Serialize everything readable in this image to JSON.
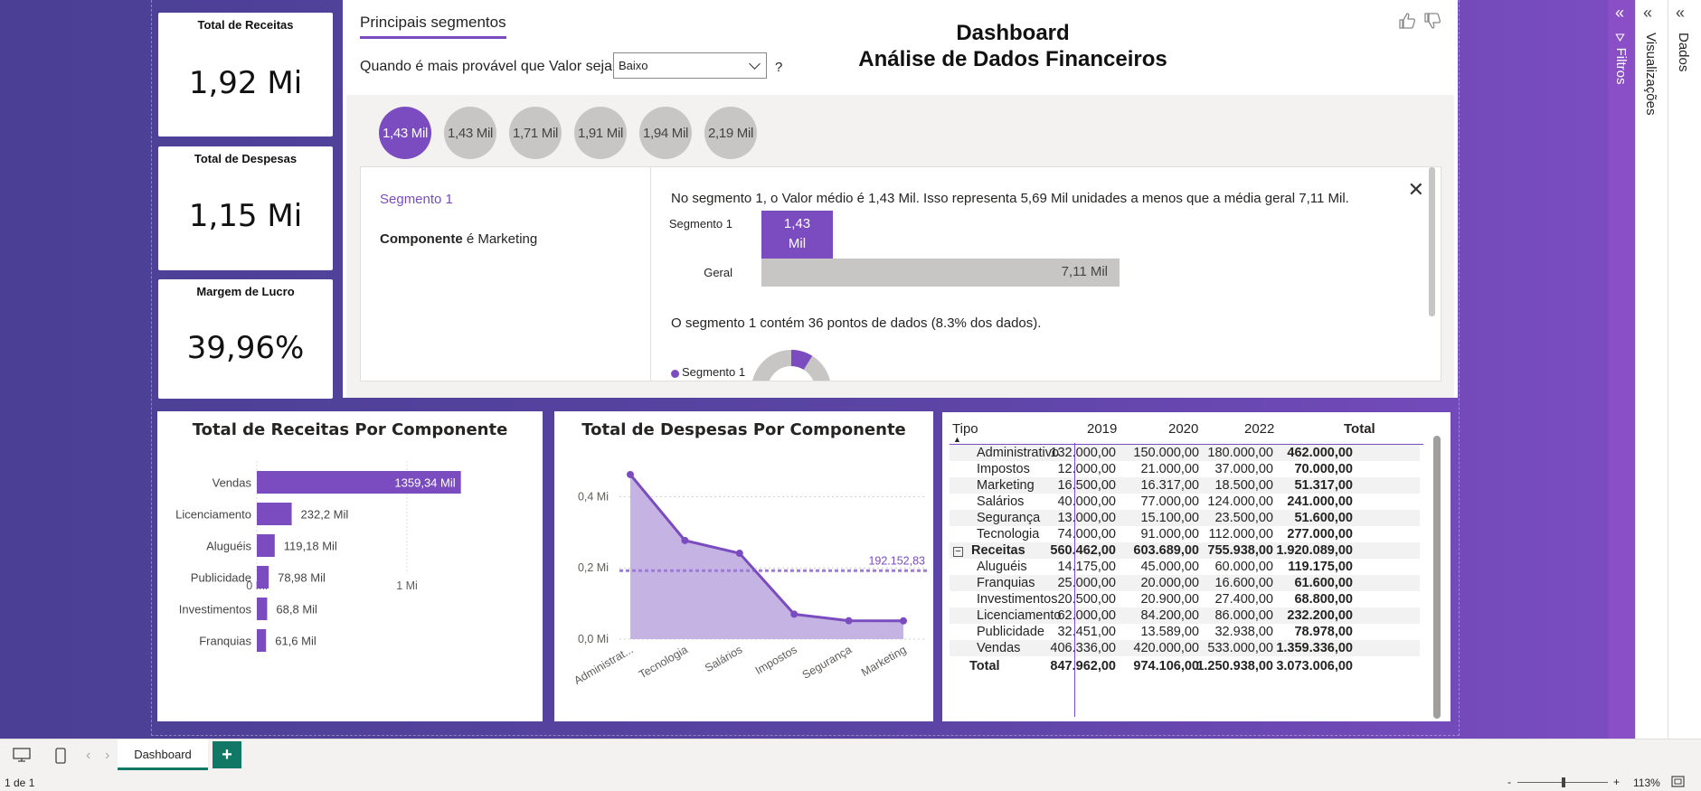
{
  "kpis": [
    {
      "title": "Total de Receitas",
      "value": "1,92 Mi"
    },
    {
      "title": "Total de Despesas",
      "value": "1,15 Mi"
    },
    {
      "title": "Margem de Lucro",
      "value": "39,96%"
    }
  ],
  "key_influencers": {
    "tab_title": "Principais segmentos",
    "question": "Quando é mais provável que Valor seja",
    "dropdown_value": "Baixo",
    "question_mark": "?",
    "segments": [
      "1,43 Mil",
      "1,43 Mil",
      "1,71 Mil",
      "1,91 Mil",
      "1,94 Mil",
      "2,19 Mil"
    ],
    "selected": {
      "name": "Segmento 1",
      "cond_field": "Componente",
      "cond_rest": " é Marketing",
      "description": "No segmento 1, o Valor médio é 1,43 Mil. Isso representa 5,69 Mil unidades a menos que a média geral 7,11 Mil.",
      "bar1_label": "Segmento 1",
      "bar1_value_line1": "1,43",
      "bar1_value_line2": "Mil",
      "bar2_label": "Geral",
      "bar2_value": "7,11 Mil",
      "count_text": "O segmento 1 contém 36 pontos de dados (8.3% dos dados).",
      "legend": "Segmento 1"
    },
    "close_glyph": "✕"
  },
  "header": {
    "line1": "Dashboard",
    "line2": "Análise de Dados Financeiros"
  },
  "icons": {
    "thumbs_up": "thumbs-up-icon",
    "thumbs_down": "thumbs-down-icon"
  },
  "receitas_chart": {
    "title": "Total de Receitas Por Componente"
  },
  "despesas_chart": {
    "title": "Total de Despesas Por Componente"
  },
  "chart_data": [
    {
      "type": "bar",
      "orientation": "horizontal",
      "title": "Total de Receitas Por Componente",
      "categories": [
        "Vendas",
        "Licenciamento",
        "Aluguéis",
        "Publicidade",
        "Investimentos",
        "Franquias"
      ],
      "values": [
        1359.34,
        232.2,
        119.18,
        78.98,
        68.8,
        61.6
      ],
      "value_labels": [
        "1359,34 Mil",
        "232,2 Mil",
        "119,18 Mil",
        "78,98 Mil",
        "68,8 Mil",
        "61,6 Mil"
      ],
      "x_ticks": [
        "0 Mi",
        "1 Mi"
      ],
      "xlim": [
        0,
        1000
      ],
      "unit": "Mil",
      "color": "#7a4cc0",
      "grid": true
    },
    {
      "type": "area",
      "title": "Total de Despesas Por Componente",
      "categories": [
        "Administrat...",
        "Tecnologia",
        "Salários",
        "Impostos",
        "Segurança",
        "Marketing"
      ],
      "values": [
        462000,
        277000,
        241000,
        70000,
        51600,
        51317
      ],
      "y_ticks": [
        "0,0 Mi",
        "0,2 Mi",
        "0,4 Mi"
      ],
      "ylim": [
        0,
        0.5
      ],
      "average_line": 192152.83,
      "average_label": "192.152,83",
      "color": "#7a4cc0",
      "fill": "#c5b3e3",
      "grid": true
    }
  ],
  "table": {
    "headers": [
      "Tipo",
      "2019",
      "2020",
      "2022",
      "Total"
    ],
    "rows": [
      {
        "name": "Administrativo",
        "v": [
          "132.000,00",
          "150.000,00",
          "180.000,00",
          "462.000,00"
        ],
        "indent": true,
        "band": true
      },
      {
        "name": "Impostos",
        "v": [
          "12.000,00",
          "21.000,00",
          "37.000,00",
          "70.000,00"
        ],
        "indent": true,
        "band": false
      },
      {
        "name": "Marketing",
        "v": [
          "16.500,00",
          "16.317,00",
          "18.500,00",
          "51.317,00"
        ],
        "indent": true,
        "band": true
      },
      {
        "name": "Salários",
        "v": [
          "40.000,00",
          "77.000,00",
          "124.000,00",
          "241.000,00"
        ],
        "indent": true,
        "band": false
      },
      {
        "name": "Segurança",
        "v": [
          "13.000,00",
          "15.100,00",
          "23.500,00",
          "51.600,00"
        ],
        "indent": true,
        "band": true
      },
      {
        "name": "Tecnologia",
        "v": [
          "74.000,00",
          "91.000,00",
          "112.000,00",
          "277.000,00"
        ],
        "indent": true,
        "band": false
      },
      {
        "name": "Receitas",
        "v": [
          "560.462,00",
          "603.689,00",
          "755.938,00",
          "1.920.089,00"
        ],
        "indent": false,
        "group": true,
        "band": true
      },
      {
        "name": "Aluguéis",
        "v": [
          "14.175,00",
          "45.000,00",
          "60.000,00",
          "119.175,00"
        ],
        "indent": true,
        "band": false
      },
      {
        "name": "Franquias",
        "v": [
          "25.000,00",
          "20.000,00",
          "16.600,00",
          "61.600,00"
        ],
        "indent": true,
        "band": true
      },
      {
        "name": "Investimentos",
        "v": [
          "20.500,00",
          "20.900,00",
          "27.400,00",
          "68.800,00"
        ],
        "indent": true,
        "band": false
      },
      {
        "name": "Licenciamento",
        "v": [
          "62.000,00",
          "84.200,00",
          "86.000,00",
          "232.200,00"
        ],
        "indent": true,
        "band": true
      },
      {
        "name": "Publicidade",
        "v": [
          "32.451,00",
          "13.589,00",
          "32.938,00",
          "78.978,00"
        ],
        "indent": true,
        "band": false
      },
      {
        "name": "Vendas",
        "v": [
          "406.336,00",
          "420.000,00",
          "533.000,00",
          "1.359.336,00"
        ],
        "indent": true,
        "band": true
      }
    ],
    "total": {
      "name": "Total",
      "v": [
        "847.962,00",
        "974.106,00",
        "1.250.938,00",
        "3.073.006,00"
      ]
    },
    "group_toggle": "−"
  },
  "panes": {
    "filtros": "Filtros",
    "visualizacoes": "Visualizações",
    "dados": "Dados",
    "collapse_glyph": "«"
  },
  "bottom": {
    "page_tab": "Dashboard",
    "add_label": "+",
    "nav_prev": "‹",
    "nav_next": "›"
  },
  "status": {
    "page_indicator": "1 de 1",
    "zoom": "113%",
    "zoom_minus": "-",
    "zoom_plus": "+"
  }
}
